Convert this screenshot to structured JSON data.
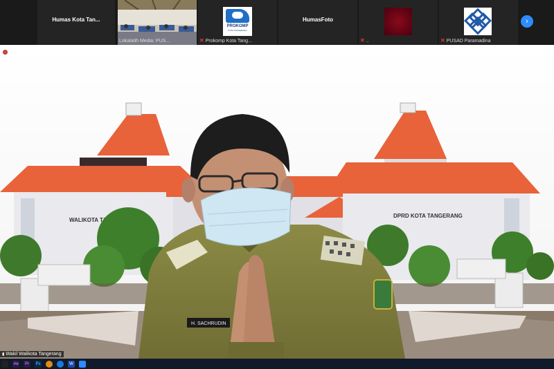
{
  "participants": [
    {
      "name": "Humas Kota Tan...",
      "label_position": "center"
    },
    {
      "name": "Lokalatih Media: PUS...",
      "label_position": "bottom",
      "muted": false
    },
    {
      "name": "Prokomp Kota Tang...",
      "label_position": "bottom",
      "muted": true,
      "logo_text": "PROKOMP",
      "logo_subtext": "KOTA TANGERANG"
    },
    {
      "name": "HumasFoto",
      "label_position": "center"
    },
    {
      "name": "..",
      "label_position": "bottom",
      "muted": true
    },
    {
      "name": "PUSAD Paramadina",
      "label_position": "bottom",
      "muted": true
    }
  ],
  "active_speaker": {
    "name": "Wakil Walikota Tangerang"
  },
  "background": {
    "building_left_sign": "WALIKOTA TANGERANG",
    "building_right_sign": "DPRD KOTA TANGERANG"
  },
  "badge": {
    "name_tag": "H. SACHRUDIN"
  },
  "taskbar": {
    "apps": [
      "",
      "Ae",
      "Pr",
      "Ps",
      "",
      "",
      "W",
      ""
    ]
  },
  "colors": {
    "accent": "#2d8cff",
    "roof": "#e8623a",
    "uniform": "#8a8a3a"
  }
}
